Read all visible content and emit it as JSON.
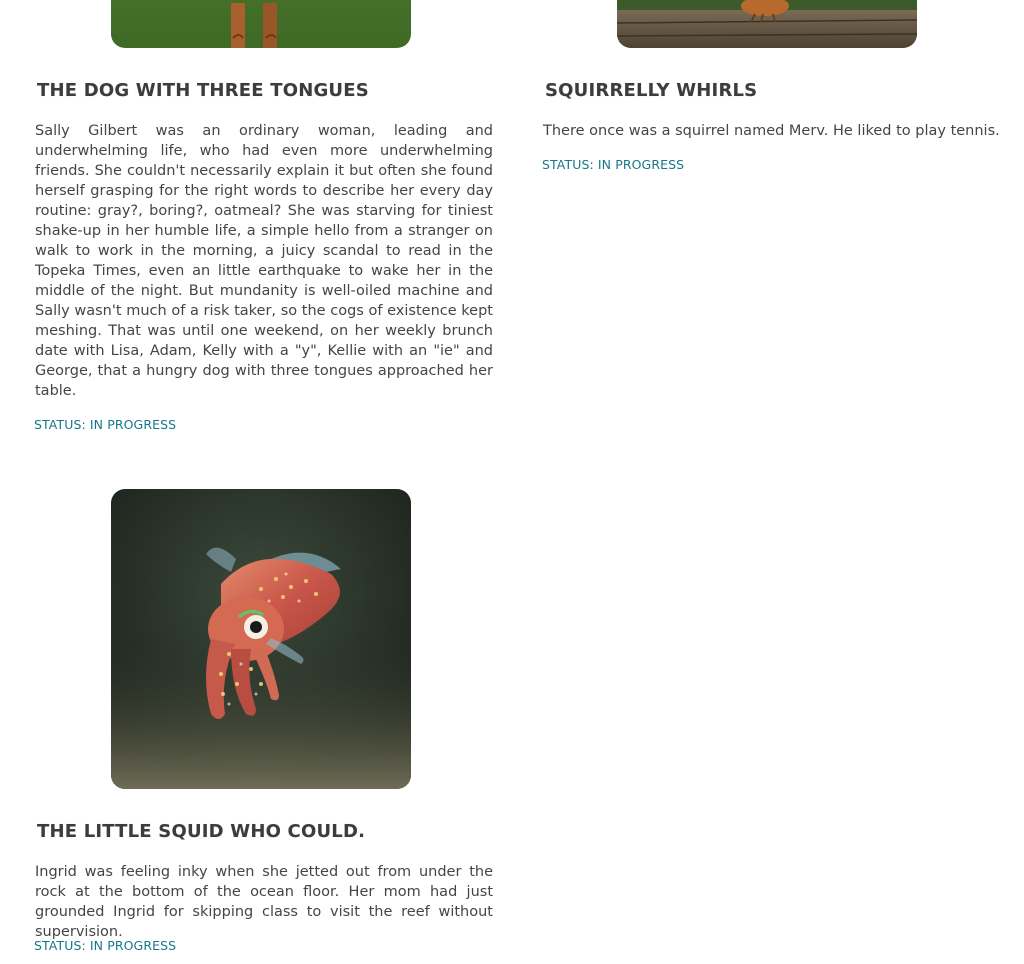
{
  "stories": [
    {
      "image_icon": "dog-photo",
      "title": "THE DOG WITH THREE TONGUES",
      "summary": "Sally Gilbert was an ordinary woman, leading and underwhelming life, who had even more underwhelming friends. She couldn't necessarily explain it but often she found herself grasping for the right words to describe her every day routine: gray?, boring?, oatmeal? She was starving for tiniest shake-up in her humble life, a simple hello from a stranger on walk to work in the morning, a juicy scandal to read in the Topeka Times, even an little earthquake to wake her in the middle of the night. But mundanity is well-oiled machine and Sally wasn't much of a risk taker, so the cogs of existence kept meshing. That was until one weekend, on her weekly brunch date with Lisa, Adam, Kelly with a \"y\", Kellie with an \"ie\" and George, that a hungry dog with three tongues approached her table.",
      "status": "STATUS: IN PROGRESS"
    },
    {
      "image_icon": "squirrel-photo",
      "title": "SQUIRRELLY WHIRLS",
      "summary": "There once was a squirrel named Merv. He liked to play tennis.",
      "status": "STATUS: IN PROGRESS"
    },
    {
      "image_icon": "squid-photo",
      "title": "THE LITTLE SQUID WHO COULD.",
      "summary": "Ingrid was feeling inky when she jetted out from under the rock at the bottom of the ocean floor. Her mom had just grounded Ingrid for skipping class to visit the reef without supervision.",
      "status": "STATUS: IN PROGRESS"
    }
  ],
  "colors": {
    "status_link": "#17778a",
    "title_text": "#3c3c3c",
    "body_text": "#454545"
  }
}
